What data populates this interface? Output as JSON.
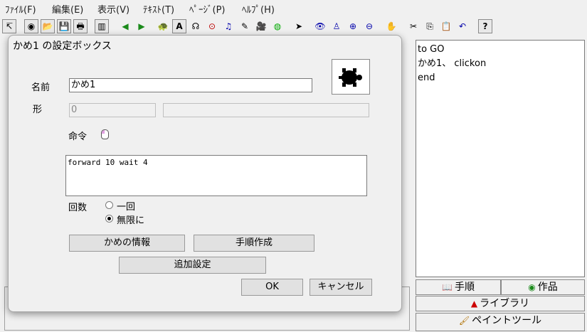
{
  "menu": [
    "ﾌｧｲﾙ(F)",
    "編集(E)",
    "表示(V)",
    "ﾃｷｽﾄ(T)",
    "ﾍﾟｰｼﾞ(P)",
    "ﾍﾙﾌﾟ(H)"
  ],
  "toolbar": {
    "icons": [
      "select-page-icon",
      "new-page-icon",
      "open-icon",
      "save-icon",
      "print-icon",
      "properties-icon",
      "back-icon",
      "forward-icon",
      "turtle-hatch-icon",
      "text-box-icon",
      "turtle-cursor-icon",
      "slider-icon",
      "music-icon",
      "draw-icon",
      "movie-icon",
      "globe-icon",
      "pointer-icon",
      "eye-icon",
      "stamp-icon",
      "zoom-in-icon",
      "zoom-out-icon",
      "stop-hand-icon",
      "cut-icon",
      "copy-icon",
      "paste-icon",
      "undo-icon",
      "help-icon"
    ],
    "glyphs": [
      "↸",
      "◉",
      "📂",
      "💾",
      "🖶",
      "▥",
      "◀",
      "▶",
      "🐢",
      "A",
      "☊",
      "⊙",
      "♫",
      "✎",
      "🎥",
      "◍",
      "➤",
      "👁",
      "♙",
      "⊕",
      "⊖",
      "✋",
      "✂",
      "⎘",
      "📋",
      "↶",
      "?"
    ]
  },
  "script_panel": {
    "lines": [
      "to GO",
      "かめ1、 clickon",
      "end"
    ]
  },
  "side_buttons": {
    "procedures": "手順",
    "works": "作品",
    "library": "ライブラリ",
    "paint_tool": "ペイントツール"
  },
  "dialog": {
    "title": "かめ1 の設定ボックス",
    "name_label": "名前",
    "name_value": "かめ1",
    "shape_label": "形",
    "shape_value": "0",
    "shape_extra": "",
    "command_label": "命令",
    "command_text": "forward 10 wait 4",
    "count_label": "回数",
    "once_label": "一回",
    "forever_label": "無限に",
    "selected_count": "forever",
    "turtle_info_button": "かめの情報",
    "make_procedure_button": "手順作成",
    "extra_settings_button": "追加設定",
    "ok_button": "OK",
    "cancel_button": "キャンセル"
  }
}
